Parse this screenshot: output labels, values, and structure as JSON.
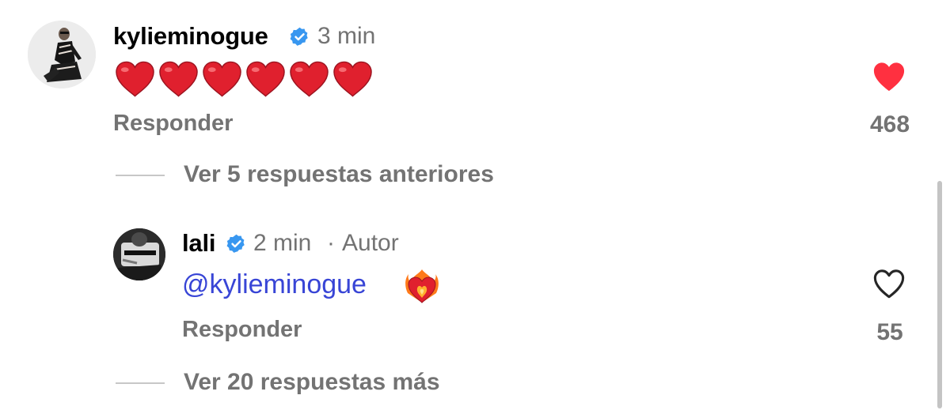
{
  "comments": [
    {
      "username": "kylieminogue",
      "time": "3 min",
      "hearts_count": 6,
      "reply_label": "Responder",
      "likes": "468",
      "liked": true
    },
    {
      "username": "lali",
      "time": "2 min",
      "separator": "·",
      "author_tag": "Autor",
      "mention": "@kylieminogue",
      "reply_label": "Responder",
      "likes": "55",
      "liked": false
    }
  ],
  "view_previous_replies": "Ver 5 respuestas anteriores",
  "view_more_replies": "Ver 20 respuestas más",
  "colors": {
    "verified": "#3897f0",
    "like_red": "#ff3040",
    "mention_blue": "#3845d6",
    "secondary_text": "#737373"
  }
}
